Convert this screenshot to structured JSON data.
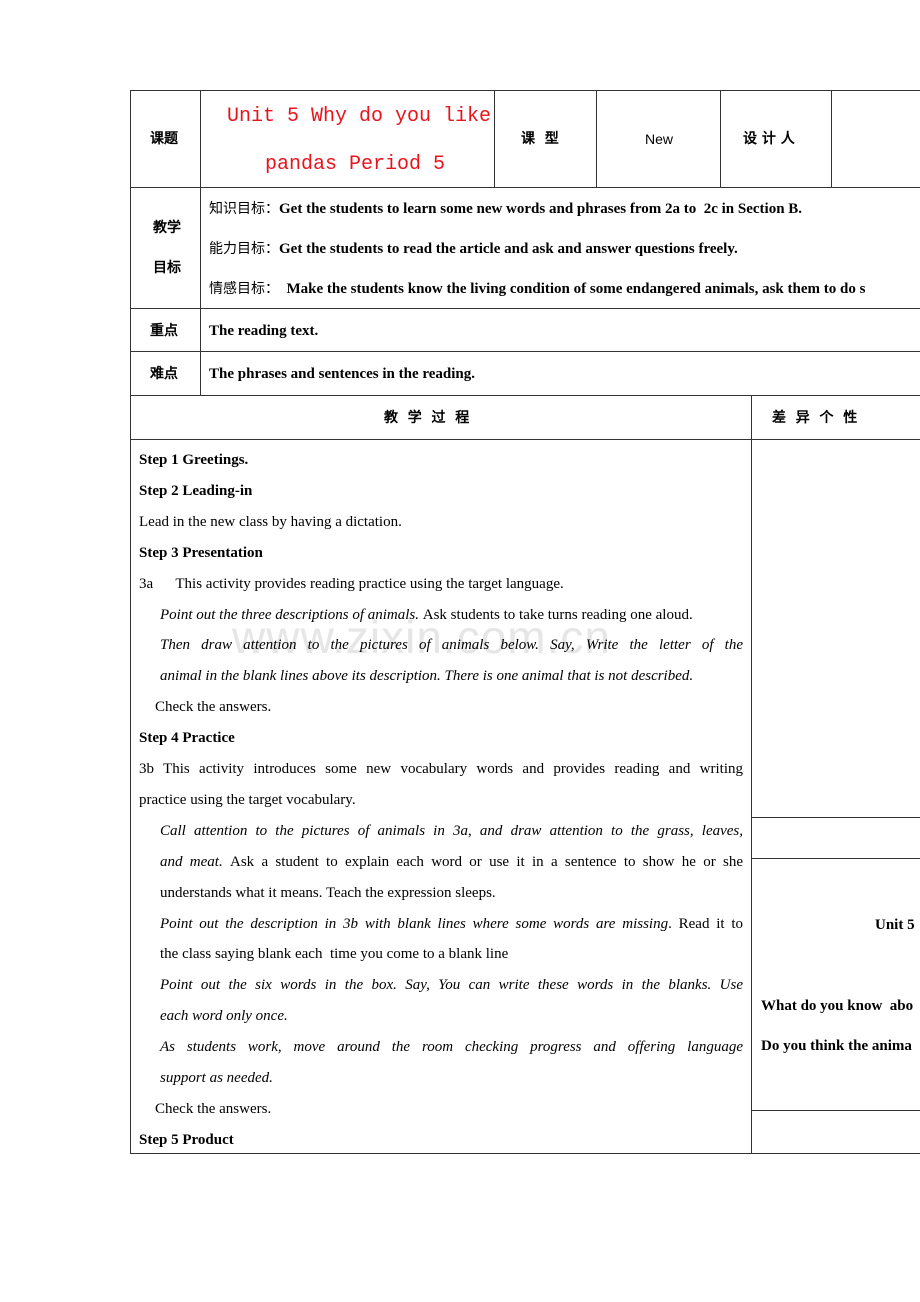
{
  "header": {
    "topic_label": "课题",
    "title_line1": "Unit 5 Why do you like",
    "title_line2": "pandas Period 5",
    "type_label": "课  型",
    "type_value": "New",
    "designer_label": "设 计 人",
    "title_color": "#e8141c"
  },
  "objectives": {
    "label_line1": "教学",
    "label_line2": "目标",
    "items": [
      {
        "label": "知识目标：",
        "text": "Get the students to learn some new words and phrases from 2a to  2c in Section B."
      },
      {
        "label": "能力目标：",
        "text": "Get the students to read the article and ask and answer questions freely."
      },
      {
        "label": "情感目标：",
        "text": "  Make the students know the living condition of some endangered animals, ask them to do s"
      }
    ]
  },
  "key_point": {
    "label": "重点",
    "text": "The reading text."
  },
  "difficult_point": {
    "label": "难点",
    "text": "The phrases and sentences in the reading."
  },
  "process": {
    "header": "教  学  过  程",
    "side_header": "差  异  个  性",
    "lines": [
      {
        "bold": true,
        "segs": [
          {
            "t": "Step 1 Greetings."
          }
        ]
      },
      {
        "bold": true,
        "segs": [
          {
            "t": "Step 2 Leading-in"
          }
        ]
      },
      {
        "segs": [
          {
            "t": "Lead in the new class by having a dictation."
          }
        ]
      },
      {
        "bold": true,
        "segs": [
          {
            "t": "Step 3 Presentation"
          }
        ]
      },
      {
        "segs": [
          {
            "t": "3a      This activity provides reading practice using the target language."
          }
        ]
      },
      {
        "indent": 1,
        "segs": [
          {
            "t": "Point out the three descriptions of animals. ",
            "i": true
          },
          {
            "t": "Ask students to take turns reading one aloud."
          }
        ]
      },
      {
        "indent": 1,
        "just": true,
        "segs": [
          {
            "t": "Then draw attention to the pictures of animals below.   Say, Write the letter of the",
            "i": true
          }
        ]
      },
      {
        "indent": 1,
        "segs": [
          {
            "t": "animal in the blank lines above its description. There is one animal that is not described.",
            "i": true
          }
        ]
      },
      {
        "indent": 2,
        "segs": [
          {
            "t": "Check the answers."
          }
        ]
      },
      {
        "bold": true,
        "segs": [
          {
            "t": "Step 4 Practice"
          }
        ]
      },
      {
        "just": true,
        "segs": [
          {
            "t": "3b      This activity introduces some new vocabulary words and provides reading and writing"
          }
        ]
      },
      {
        "segs": [
          {
            "t": "practice using the target vocabulary."
          }
        ]
      },
      {
        "indent": 1,
        "just": true,
        "segs": [
          {
            "t": "Call attention to the pictures of animals in 3a",
            "i": true
          },
          {
            "t": ", "
          },
          {
            "t": "and draw attention to the grass, leaves,",
            "i": true
          }
        ]
      },
      {
        "indent": 1,
        "just": true,
        "segs": [
          {
            "t": "and meat. ",
            "i": true
          },
          {
            "t": "Ask a student to explain each word or use it in a sentence to show he or she"
          }
        ]
      },
      {
        "indent": 1,
        "segs": [
          {
            "t": "understands what it means. Teach the expression sleeps."
          }
        ]
      },
      {
        "indent": 1,
        "just": true,
        "segs": [
          {
            "t": "Point out the description in 3b with blank lines where some words are missing",
            "i": true
          },
          {
            "t": ". Read it to"
          }
        ]
      },
      {
        "indent": 1,
        "segs": [
          {
            "t": "the class saying blank each  time you come to a blank line"
          }
        ]
      },
      {
        "indent": 1,
        "just": true,
        "segs": [
          {
            "t": "Point  out the six words in the box. Say, You can write these words in the blanks. Use",
            "i": true
          }
        ]
      },
      {
        "indent": 1,
        "segs": [
          {
            "t": "each word only once.",
            "i": true
          }
        ]
      },
      {
        "indent": 1,
        "just": true,
        "segs": [
          {
            "t": "As students work, move around the room checking progress and offering language",
            "i": true
          }
        ]
      },
      {
        "indent": 1,
        "segs": [
          {
            "t": "support as needed.",
            "i": true
          }
        ]
      },
      {
        "indent": 2,
        "segs": [
          {
            "t": "Check the answers."
          }
        ]
      },
      {
        "bold": true,
        "segs": [
          {
            "t": "Step 5 Product"
          }
        ]
      }
    ],
    "side_notes": {
      "title": "Unit 5",
      "q1": "What do you know  abo",
      "q2": "Do you think the anima"
    }
  },
  "watermark": "www.zixin.com.cn"
}
